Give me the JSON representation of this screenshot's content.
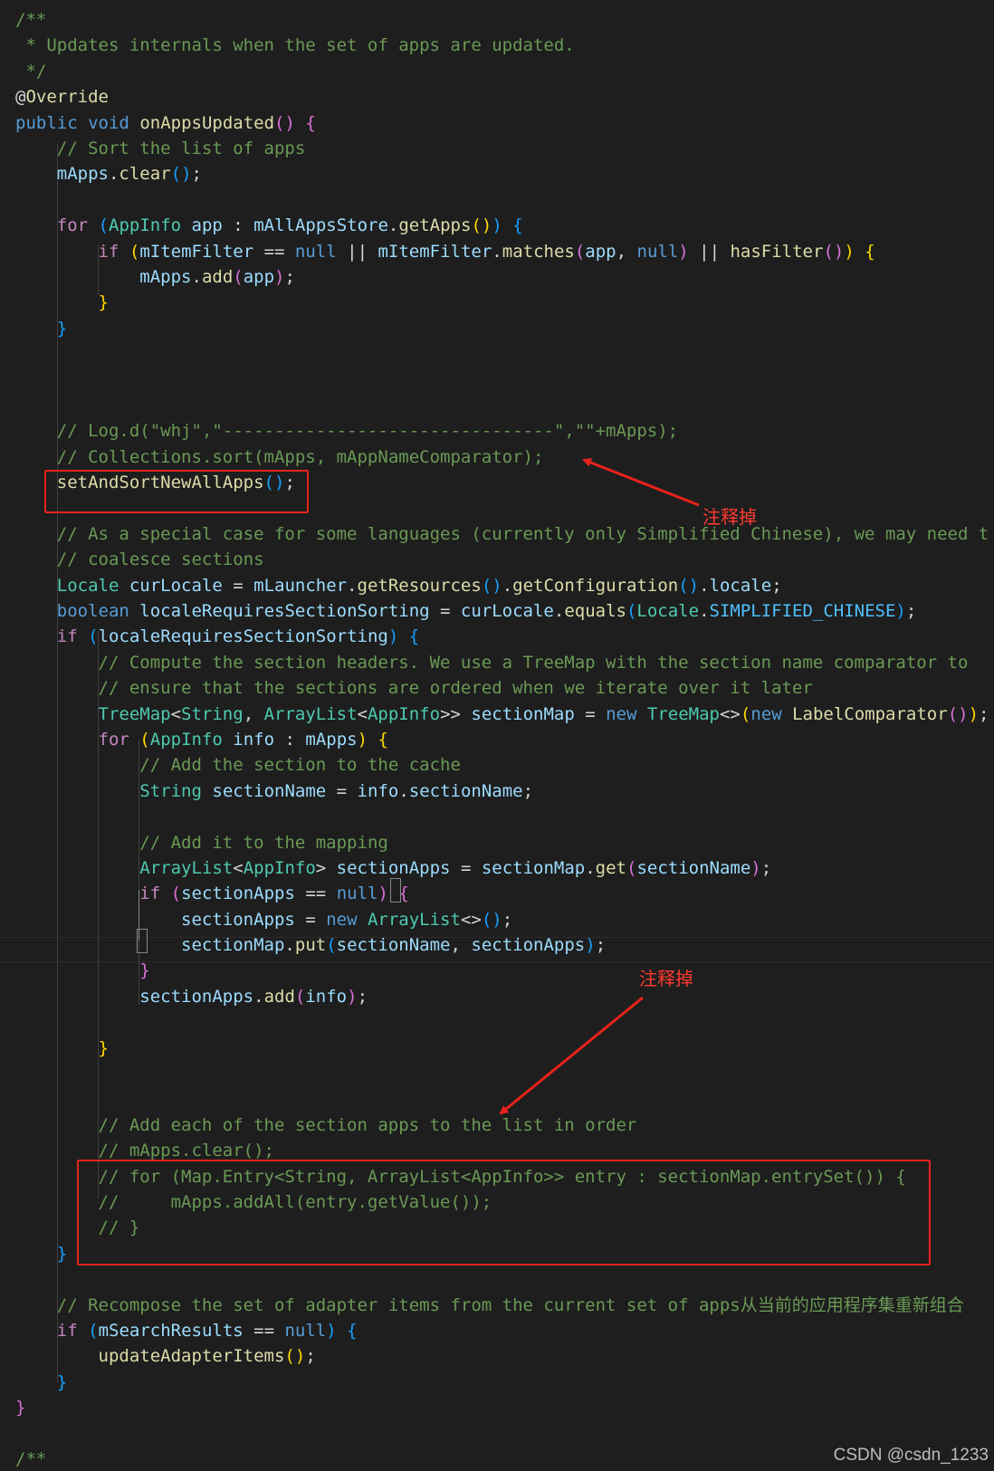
{
  "editor": {
    "language": "java",
    "background": "#1e1e1e",
    "lines": [
      [
        [
          "tk-comment",
          "/**"
        ]
      ],
      [
        [
          "tk-comment",
          " * Updates internals when the set of apps are updated."
        ]
      ],
      [
        [
          "tk-comment",
          " */"
        ]
      ],
      [
        [
          "tk-plain",
          "@"
        ],
        [
          "tk-annot",
          "Override"
        ]
      ],
      [
        [
          "tk-keyword",
          "public"
        ],
        [
          "tk-plain",
          " "
        ],
        [
          "tk-keyword",
          "void"
        ],
        [
          "tk-plain",
          " "
        ],
        [
          "tk-fn",
          "onAppsUpdated"
        ],
        [
          "tk-b2",
          "()"
        ],
        [
          "tk-plain",
          " "
        ],
        [
          "tk-b2",
          "{"
        ]
      ],
      [
        [
          "tk-plain",
          "    "
        ],
        [
          "tk-comment",
          "// Sort the list of apps"
        ]
      ],
      [
        [
          "tk-plain",
          "    "
        ],
        [
          "tk-var",
          "mApps"
        ],
        [
          "tk-plain",
          "."
        ],
        [
          "tk-fn",
          "clear"
        ],
        [
          "tk-b3",
          "()"
        ],
        [
          "tk-plain",
          ";"
        ]
      ],
      [
        [
          "tk-plain",
          ""
        ]
      ],
      [
        [
          "tk-plain",
          "    "
        ],
        [
          "tk-control",
          "for"
        ],
        [
          "tk-plain",
          " "
        ],
        [
          "tk-b3",
          "("
        ],
        [
          "tk-type",
          "AppInfo"
        ],
        [
          "tk-plain",
          " "
        ],
        [
          "tk-var",
          "app"
        ],
        [
          "tk-plain",
          " : "
        ],
        [
          "tk-var",
          "mAllAppsStore"
        ],
        [
          "tk-plain",
          "."
        ],
        [
          "tk-fn",
          "getApps"
        ],
        [
          "tk-b1",
          "()"
        ],
        [
          "tk-b3",
          ")"
        ],
        [
          "tk-plain",
          " "
        ],
        [
          "tk-b3",
          "{"
        ]
      ],
      [
        [
          "tk-plain",
          "        "
        ],
        [
          "tk-control",
          "if"
        ],
        [
          "tk-plain",
          " "
        ],
        [
          "tk-b1",
          "("
        ],
        [
          "tk-var",
          "mItemFilter"
        ],
        [
          "tk-plain",
          " == "
        ],
        [
          "tk-keyword",
          "null"
        ],
        [
          "tk-plain",
          " || "
        ],
        [
          "tk-var",
          "mItemFilter"
        ],
        [
          "tk-plain",
          "."
        ],
        [
          "tk-fn",
          "matches"
        ],
        [
          "tk-b2",
          "("
        ],
        [
          "tk-var",
          "app"
        ],
        [
          "tk-plain",
          ", "
        ],
        [
          "tk-keyword",
          "null"
        ],
        [
          "tk-b2",
          ")"
        ],
        [
          "tk-plain",
          " || "
        ],
        [
          "tk-fn",
          "hasFilter"
        ],
        [
          "tk-b2",
          "()"
        ],
        [
          "tk-b1",
          ")"
        ],
        [
          "tk-plain",
          " "
        ],
        [
          "tk-b1",
          "{"
        ]
      ],
      [
        [
          "tk-plain",
          "            "
        ],
        [
          "tk-var",
          "mApps"
        ],
        [
          "tk-plain",
          "."
        ],
        [
          "tk-fn",
          "add"
        ],
        [
          "tk-b2",
          "("
        ],
        [
          "tk-var",
          "app"
        ],
        [
          "tk-b2",
          ")"
        ],
        [
          "tk-plain",
          ";"
        ]
      ],
      [
        [
          "tk-plain",
          "        "
        ],
        [
          "tk-b1",
          "}"
        ]
      ],
      [
        [
          "tk-plain",
          "    "
        ],
        [
          "tk-b3",
          "}"
        ]
      ],
      [
        [
          "tk-plain",
          ""
        ]
      ],
      [
        [
          "tk-plain",
          ""
        ]
      ],
      [
        [
          "tk-plain",
          ""
        ]
      ],
      [
        [
          "tk-plain",
          "    "
        ],
        [
          "tk-comment",
          "// Log.d(\"whj\",\"--------------------------------\",\"\"+mApps);"
        ]
      ],
      [
        [
          "tk-plain",
          "    "
        ],
        [
          "tk-comment",
          "// Collections.sort(mApps, mAppNameComparator);"
        ]
      ],
      [
        [
          "tk-plain",
          "    "
        ],
        [
          "tk-fn",
          "setAndSortNewAllApps"
        ],
        [
          "tk-b3",
          "()"
        ],
        [
          "tk-plain",
          ";"
        ]
      ],
      [
        [
          "tk-plain",
          ""
        ]
      ],
      [
        [
          "tk-plain",
          "    "
        ],
        [
          "tk-comment",
          "// As a special case for some languages (currently only Simplified Chinese), we may need t"
        ]
      ],
      [
        [
          "tk-plain",
          "    "
        ],
        [
          "tk-comment",
          "// coalesce sections"
        ]
      ],
      [
        [
          "tk-plain",
          "    "
        ],
        [
          "tk-type",
          "Locale"
        ],
        [
          "tk-plain",
          " "
        ],
        [
          "tk-var",
          "curLocale"
        ],
        [
          "tk-plain",
          " = "
        ],
        [
          "tk-var",
          "mLauncher"
        ],
        [
          "tk-plain",
          "."
        ],
        [
          "tk-fn",
          "getResources"
        ],
        [
          "tk-b3",
          "()"
        ],
        [
          "tk-plain",
          "."
        ],
        [
          "tk-fn",
          "getConfiguration"
        ],
        [
          "tk-b3",
          "()"
        ],
        [
          "tk-plain",
          "."
        ],
        [
          "tk-var",
          "locale"
        ],
        [
          "tk-plain",
          ";"
        ]
      ],
      [
        [
          "tk-plain",
          "    "
        ],
        [
          "tk-keyword",
          "boolean"
        ],
        [
          "tk-plain",
          " "
        ],
        [
          "tk-var",
          "localeRequiresSectionSorting"
        ],
        [
          "tk-plain",
          " = "
        ],
        [
          "tk-var",
          "curLocale"
        ],
        [
          "tk-plain",
          "."
        ],
        [
          "tk-fn",
          "equals"
        ],
        [
          "tk-b3",
          "("
        ],
        [
          "tk-type",
          "Locale"
        ],
        [
          "tk-plain",
          "."
        ],
        [
          "tk-const",
          "SIMPLIFIED_CHINESE"
        ],
        [
          "tk-b3",
          ")"
        ],
        [
          "tk-plain",
          ";"
        ]
      ],
      [
        [
          "tk-plain",
          "    "
        ],
        [
          "tk-control",
          "if"
        ],
        [
          "tk-plain",
          " "
        ],
        [
          "tk-b3",
          "("
        ],
        [
          "tk-var",
          "localeRequiresSectionSorting"
        ],
        [
          "tk-b3",
          ")"
        ],
        [
          "tk-plain",
          " "
        ],
        [
          "tk-b3",
          "{"
        ]
      ],
      [
        [
          "tk-plain",
          "        "
        ],
        [
          "tk-comment",
          "// Compute the section headers. We use a TreeMap with the section name comparator to"
        ]
      ],
      [
        [
          "tk-plain",
          "        "
        ],
        [
          "tk-comment",
          "// ensure that the sections are ordered when we iterate over it later"
        ]
      ],
      [
        [
          "tk-plain",
          "        "
        ],
        [
          "tk-type",
          "TreeMap"
        ],
        [
          "tk-plain",
          "<"
        ],
        [
          "tk-type",
          "String"
        ],
        [
          "tk-plain",
          ", "
        ],
        [
          "tk-type",
          "ArrayList"
        ],
        [
          "tk-plain",
          "<"
        ],
        [
          "tk-type",
          "AppInfo"
        ],
        [
          "tk-plain",
          ">> "
        ],
        [
          "tk-var",
          "sectionMap"
        ],
        [
          "tk-plain",
          " = "
        ],
        [
          "tk-keyword",
          "new"
        ],
        [
          "tk-plain",
          " "
        ],
        [
          "tk-type",
          "TreeMap"
        ],
        [
          "tk-plain",
          "<>"
        ],
        [
          "tk-b1",
          "("
        ],
        [
          "tk-keyword",
          "new"
        ],
        [
          "tk-plain",
          " "
        ],
        [
          "tk-fn",
          "LabelComparator"
        ],
        [
          "tk-b2",
          "()"
        ],
        [
          "tk-b1",
          ")"
        ],
        [
          "tk-plain",
          ";"
        ]
      ],
      [
        [
          "tk-plain",
          "        "
        ],
        [
          "tk-control",
          "for"
        ],
        [
          "tk-plain",
          " "
        ],
        [
          "tk-b1",
          "("
        ],
        [
          "tk-type",
          "AppInfo"
        ],
        [
          "tk-plain",
          " "
        ],
        [
          "tk-var",
          "info"
        ],
        [
          "tk-plain",
          " : "
        ],
        [
          "tk-var",
          "mApps"
        ],
        [
          "tk-b1",
          ")"
        ],
        [
          "tk-plain",
          " "
        ],
        [
          "tk-b1",
          "{"
        ]
      ],
      [
        [
          "tk-plain",
          "            "
        ],
        [
          "tk-comment",
          "// Add the section to the cache"
        ]
      ],
      [
        [
          "tk-plain",
          "            "
        ],
        [
          "tk-type",
          "String"
        ],
        [
          "tk-plain",
          " "
        ],
        [
          "tk-var",
          "sectionName"
        ],
        [
          "tk-plain",
          " = "
        ],
        [
          "tk-var",
          "info"
        ],
        [
          "tk-plain",
          "."
        ],
        [
          "tk-var",
          "sectionName"
        ],
        [
          "tk-plain",
          ";"
        ]
      ],
      [
        [
          "tk-plain",
          ""
        ]
      ],
      [
        [
          "tk-plain",
          "            "
        ],
        [
          "tk-comment",
          "// Add it to the mapping"
        ]
      ],
      [
        [
          "tk-plain",
          "            "
        ],
        [
          "tk-type",
          "ArrayList"
        ],
        [
          "tk-plain",
          "<"
        ],
        [
          "tk-type",
          "AppInfo"
        ],
        [
          "tk-plain",
          "> "
        ],
        [
          "tk-var",
          "sectionApps"
        ],
        [
          "tk-plain",
          " = "
        ],
        [
          "tk-var",
          "sectionMap"
        ],
        [
          "tk-plain",
          "."
        ],
        [
          "tk-fn",
          "get"
        ],
        [
          "tk-b2",
          "("
        ],
        [
          "tk-var",
          "sectionName"
        ],
        [
          "tk-b2",
          ")"
        ],
        [
          "tk-plain",
          ";"
        ]
      ],
      [
        [
          "tk-plain",
          "            "
        ],
        [
          "tk-control",
          "if"
        ],
        [
          "tk-plain",
          " "
        ],
        [
          "tk-b2",
          "("
        ],
        [
          "tk-var",
          "sectionApps"
        ],
        [
          "tk-plain",
          " == "
        ],
        [
          "tk-keyword",
          "null"
        ],
        [
          "tk-b2",
          ")"
        ],
        [
          "tk-plain",
          " "
        ],
        [
          "tk-b2",
          "{"
        ]
      ],
      [
        [
          "tk-plain",
          "                "
        ],
        [
          "tk-var",
          "sectionApps"
        ],
        [
          "tk-plain",
          " = "
        ],
        [
          "tk-keyword",
          "new"
        ],
        [
          "tk-plain",
          " "
        ],
        [
          "tk-type",
          "ArrayList"
        ],
        [
          "tk-plain",
          "<>"
        ],
        [
          "tk-b3",
          "()"
        ],
        [
          "tk-plain",
          ";"
        ]
      ],
      [
        [
          "tk-plain",
          "                "
        ],
        [
          "tk-var",
          "sectionMap"
        ],
        [
          "tk-plain",
          "."
        ],
        [
          "tk-fn",
          "put"
        ],
        [
          "tk-b3",
          "("
        ],
        [
          "tk-var",
          "sectionName"
        ],
        [
          "tk-plain",
          ", "
        ],
        [
          "tk-var",
          "sectionApps"
        ],
        [
          "tk-b3",
          ")"
        ],
        [
          "tk-plain",
          ";"
        ]
      ],
      [
        [
          "tk-plain",
          "            "
        ],
        [
          "tk-b2",
          "}"
        ]
      ],
      [
        [
          "tk-plain",
          "            "
        ],
        [
          "tk-var",
          "sectionApps"
        ],
        [
          "tk-plain",
          "."
        ],
        [
          "tk-fn",
          "add"
        ],
        [
          "tk-b2",
          "("
        ],
        [
          "tk-var",
          "info"
        ],
        [
          "tk-b2",
          ")"
        ],
        [
          "tk-plain",
          ";"
        ]
      ],
      [
        [
          "tk-plain",
          ""
        ]
      ],
      [
        [
          "tk-plain",
          "        "
        ],
        [
          "tk-b1",
          "}"
        ]
      ],
      [
        [
          "tk-plain",
          ""
        ]
      ],
      [
        [
          "tk-plain",
          ""
        ]
      ],
      [
        [
          "tk-plain",
          "        "
        ],
        [
          "tk-comment",
          "// Add each of the section apps to the list in order"
        ]
      ],
      [
        [
          "tk-plain",
          "        "
        ],
        [
          "tk-comment",
          "// mApps.clear();"
        ]
      ],
      [
        [
          "tk-plain",
          "        "
        ],
        [
          "tk-comment",
          "// for (Map.Entry<String, ArrayList<AppInfo>> entry : sectionMap.entrySet()) {"
        ]
      ],
      [
        [
          "tk-plain",
          "        "
        ],
        [
          "tk-comment",
          "//     mApps.addAll(entry.getValue());"
        ]
      ],
      [
        [
          "tk-plain",
          "        "
        ],
        [
          "tk-comment",
          "// }"
        ]
      ],
      [
        [
          "tk-plain",
          "    "
        ],
        [
          "tk-b3",
          "}"
        ]
      ],
      [
        [
          "tk-plain",
          ""
        ]
      ],
      [
        [
          "tk-plain",
          "    "
        ],
        [
          "tk-comment",
          "// Recompose the set of adapter items from the current set of apps"
        ],
        [
          "tk-cjk",
          "从当前的应用程序集重新组合"
        ]
      ],
      [
        [
          "tk-plain",
          "    "
        ],
        [
          "tk-control",
          "if"
        ],
        [
          "tk-plain",
          " "
        ],
        [
          "tk-b3",
          "("
        ],
        [
          "tk-var",
          "mSearchResults"
        ],
        [
          "tk-plain",
          " == "
        ],
        [
          "tk-keyword",
          "null"
        ],
        [
          "tk-b3",
          ")"
        ],
        [
          "tk-plain",
          " "
        ],
        [
          "tk-b3",
          "{"
        ]
      ],
      [
        [
          "tk-plain",
          "        "
        ],
        [
          "tk-fn",
          "updateAdapterItems"
        ],
        [
          "tk-b1",
          "()"
        ],
        [
          "tk-plain",
          ";"
        ]
      ],
      [
        [
          "tk-plain",
          "    "
        ],
        [
          "tk-b3",
          "}"
        ]
      ],
      [
        [
          "tk-b2",
          "}"
        ]
      ],
      [
        [
          "tk-plain",
          ""
        ]
      ],
      [
        [
          "tk-comment",
          "/**"
        ]
      ]
    ]
  },
  "annotations": [
    {
      "label": "注释掉",
      "color": "#e8231b"
    },
    {
      "label": "注释掉",
      "color": "#e8231b"
    }
  ],
  "watermark": "CSDN @csdn_1233"
}
